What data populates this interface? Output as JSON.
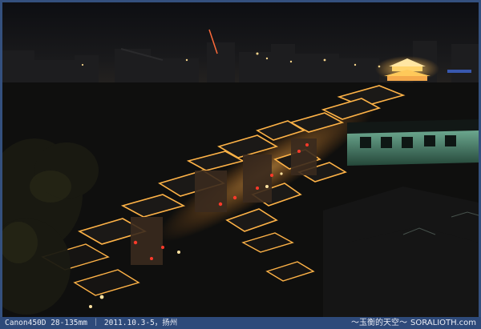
{
  "caption": {
    "camera_info": "Canon450D 28-135mm ｜ 2011.10.3-5，扬州",
    "title": "～玉衡的天空～",
    "site": "SORALIOTH.com"
  }
}
